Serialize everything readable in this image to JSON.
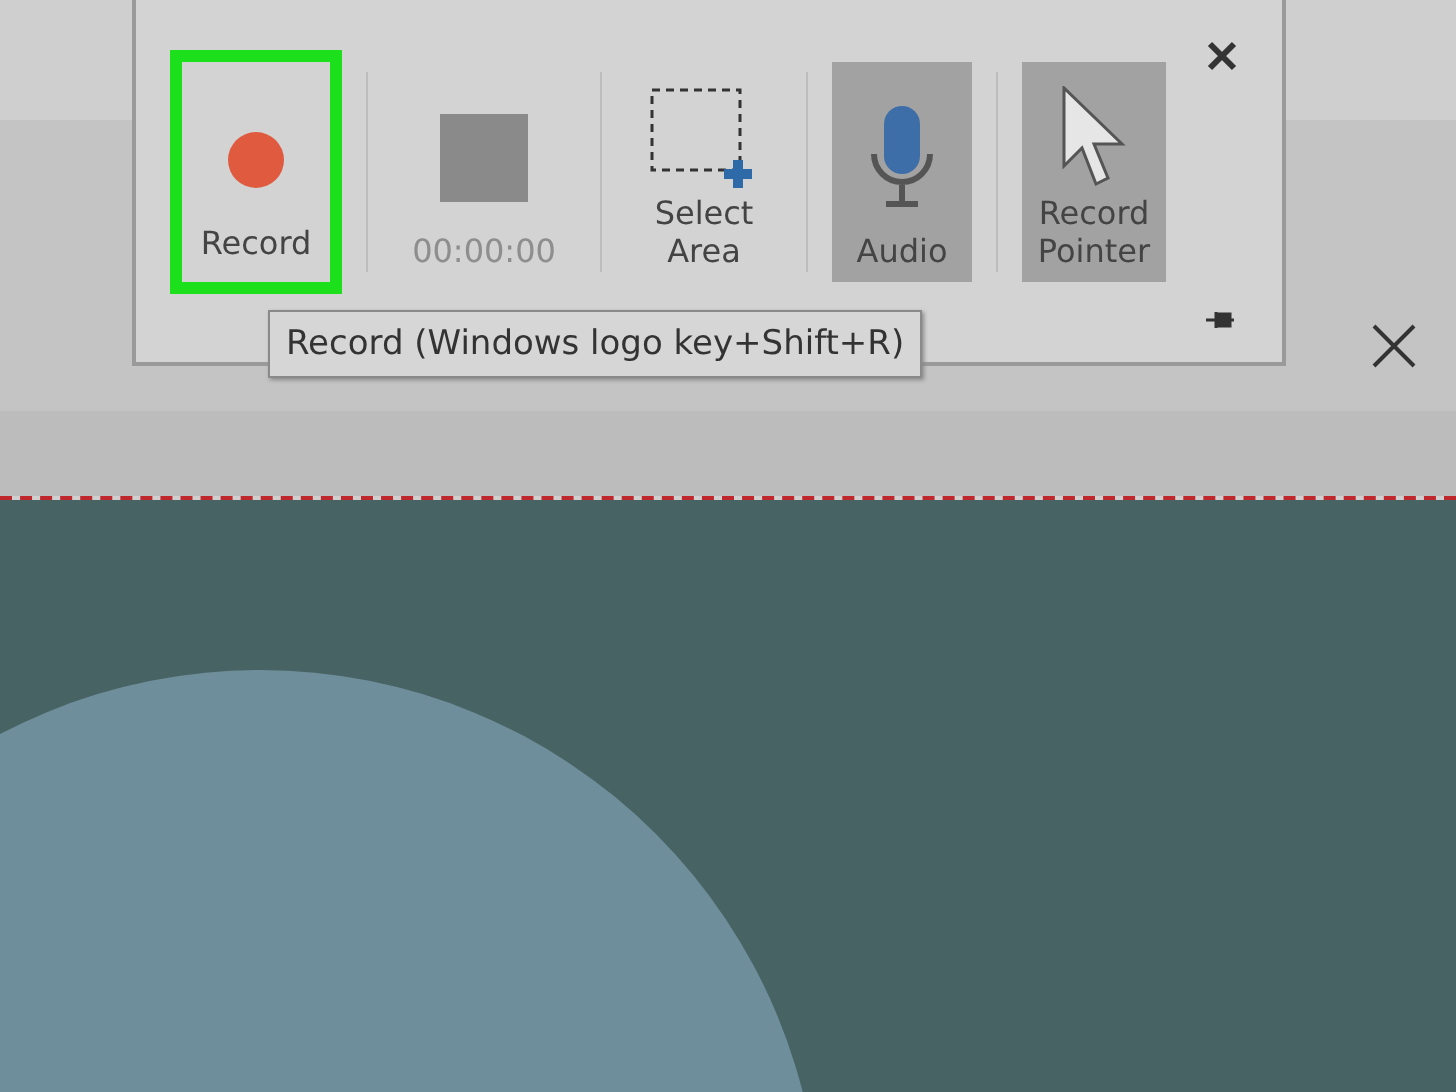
{
  "toolbar": {
    "buttons": [
      {
        "kind": "record",
        "label": "Record",
        "highlighted": true,
        "on": false
      },
      {
        "kind": "stop",
        "label": "00:00:00",
        "disabled": true,
        "on": false
      },
      {
        "kind": "area",
        "label": "Select Area",
        "on": false
      },
      {
        "kind": "audio",
        "label": "Audio",
        "on": true
      },
      {
        "kind": "pointer",
        "label": "Record Pointer",
        "on": true
      }
    ]
  },
  "tooltip": "Record (Windows logo key+Shift+R)"
}
